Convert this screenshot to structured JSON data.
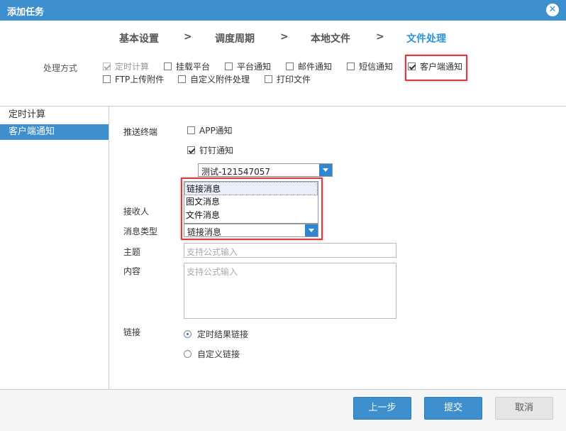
{
  "window": {
    "title": "添加任务"
  },
  "steps": {
    "s1": "基本设置",
    "s2": "调度周期",
    "s3": "本地文件",
    "s4": "文件处理",
    "arrow": ">"
  },
  "processing": {
    "label": "处理方式",
    "options": {
      "timed_calc": "定时计算",
      "mount_platform": "挂载平台",
      "platform_notify": "平台通知",
      "mail_notify": "邮件通知",
      "sms_notify": "短信通知",
      "client_notify": "客户端通知",
      "ftp_upload": "FTP上传附件",
      "custom_attach": "自定义附件处理",
      "print_file": "打印文件"
    }
  },
  "sidebar": {
    "items": [
      "定时计算",
      "客户端通知"
    ]
  },
  "form": {
    "push_label": "推送终端",
    "app_notify": "APP通知",
    "dingtalk_notify": "钉钉通知",
    "dingtalk_select": "测试-121547057",
    "receiver_label": "接收人",
    "msgtype_label": "消息类型",
    "msgtype_value": "链接消息",
    "msgtype_options": [
      "链接消息",
      "图文消息",
      "文件消息"
    ],
    "subject_label": "主题",
    "subject_placeholder": "支持公式输入",
    "content_label": "内容",
    "content_placeholder": "支持公式输入",
    "link_label": "链接",
    "link_options": {
      "timed_result": "定时结果链接",
      "custom": "自定义链接"
    }
  },
  "buttons": {
    "prev": "上一步",
    "submit": "提交",
    "cancel": "取消"
  },
  "colors": {
    "accent": "#3d8fcd",
    "active_step": "#2d92dd",
    "highlight_frame": "#e0383e"
  }
}
